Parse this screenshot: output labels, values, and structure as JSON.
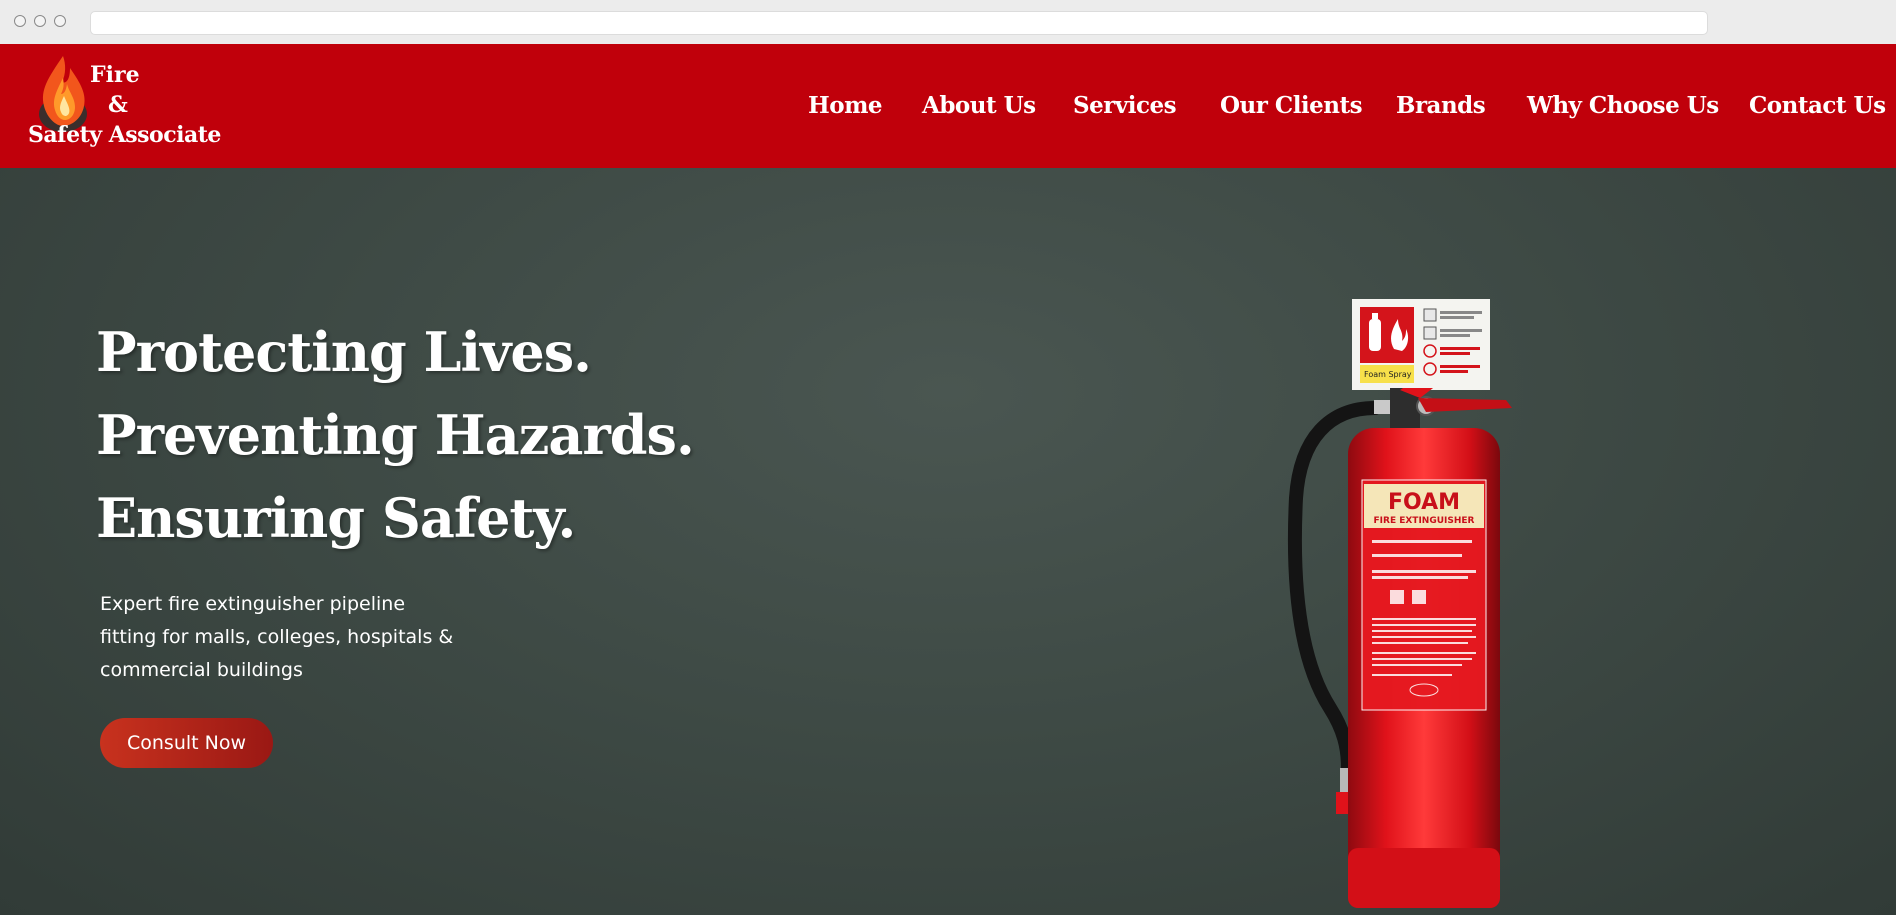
{
  "header": {
    "logo": {
      "line1": "Fire",
      "line2": "&",
      "line3": "Safety Associate"
    },
    "nav": [
      {
        "label": "Home"
      },
      {
        "label": "About Us"
      },
      {
        "label": "Services"
      },
      {
        "label": "Our Clients"
      },
      {
        "label": "Brands"
      },
      {
        "label": "Why Choose Us"
      },
      {
        "label": "Contact Us"
      }
    ]
  },
  "hero": {
    "headline": [
      "Protecting Lives.",
      "Preventing Hazards.",
      "Ensuring Safety."
    ],
    "subtitle_lines": [
      "Expert fire extinguisher pipeline",
      "fitting for malls, colleges, hospitals &",
      "commercial buildings"
    ],
    "cta_label": "Consult Now",
    "image": {
      "sign_label": "Foam Spray",
      "extinguisher_title": "FOAM",
      "extinguisher_subtitle": "FIRE EXTINGUISHER"
    }
  },
  "colors": {
    "header_bg": "#c0000b",
    "hero_bg": "#3e4a45",
    "cta_start": "#c8321e",
    "cta_end": "#9a1814",
    "extinguisher_red": "#e0121a"
  },
  "icons": [
    "flame-logo-icon",
    "fire-extinguisher-sign-icon"
  ]
}
